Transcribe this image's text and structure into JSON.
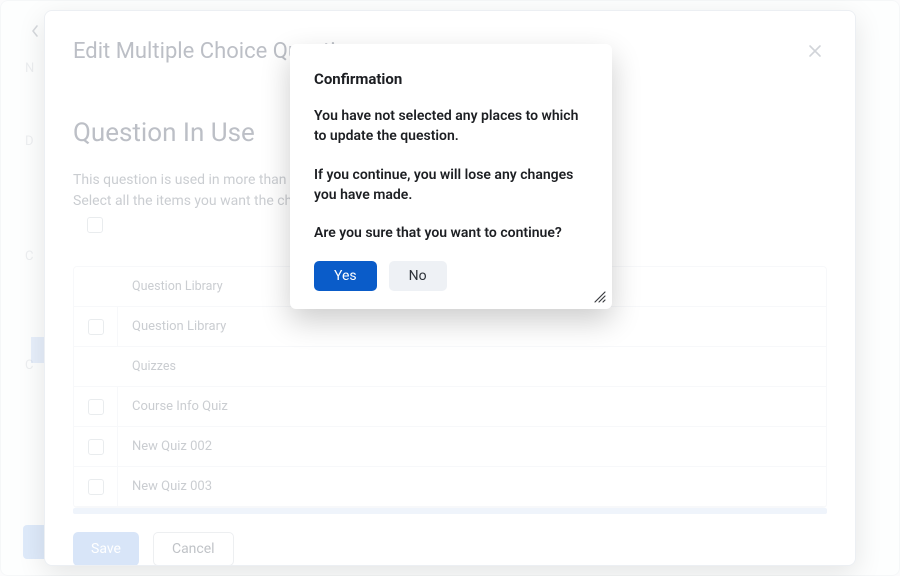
{
  "base": {
    "left_markers": [
      "N",
      "D",
      "C",
      "C"
    ]
  },
  "panel1": {
    "title": "Edit Multiple Choice Question",
    "heading": "Question In Use",
    "subtitle_line1": "This question is used in more than one",
    "subtitle_line2": "Select all the items you want the chang",
    "groups": [
      {
        "name": "Question Library",
        "items": [
          "Question Library"
        ]
      },
      {
        "name": "Quizzes",
        "items": [
          "Course Info Quiz",
          "New Quiz 002",
          "New Quiz 003"
        ]
      }
    ],
    "save_label": "Save",
    "cancel_label": "Cancel"
  },
  "dialog": {
    "title": "Confirmation",
    "para1": "You have not selected any places to which to update the question.",
    "para2": "If you continue, you will lose any changes you have made.",
    "para3": "Are you sure that you want to continue?",
    "yes_label": "Yes",
    "no_label": "No"
  }
}
